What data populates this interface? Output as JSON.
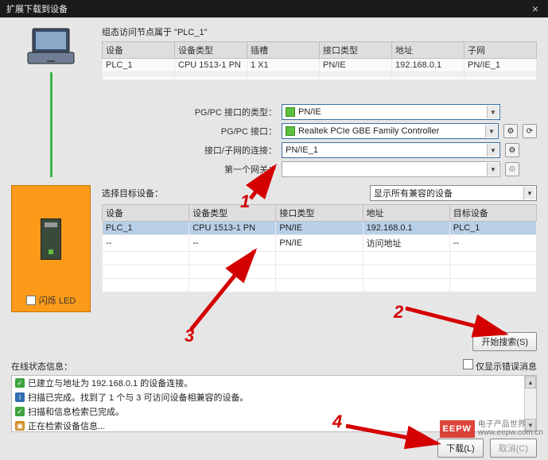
{
  "titlebar": {
    "title": "扩展下载到设备"
  },
  "topgrid": {
    "caption": "组态访问节点属于 \"PLC_1\"",
    "headers": [
      "设备",
      "设备类型",
      "插槽",
      "接口类型",
      "地址",
      "子网"
    ],
    "row": [
      "PLC_1",
      "CPU 1513-1 PN",
      "1 X1",
      "PN/IE",
      "192.168.0.1",
      "PN/IE_1"
    ]
  },
  "form": {
    "pgpc_type_label": "PG/PC 接口的类型：",
    "pgpc_type_value": "PN/IE",
    "pgpc_if_label": "PG/PC 接口：",
    "pgpc_if_value": "Realtek PCIe GBE Family Controller",
    "conn_label": "接口/子网的连接：",
    "conn_value": "PN/IE_1",
    "gateway_label": "第一个网关："
  },
  "plc_panel": {
    "led_label": "闪烁 LED"
  },
  "grid2": {
    "select_label": "选择目标设备：",
    "filter_value": "显示所有兼容的设备",
    "headers": [
      "设备",
      "设备类型",
      "接口类型",
      "地址",
      "目标设备"
    ],
    "rows": [
      [
        "PLC_1",
        "CPU 1513-1 PN",
        "PN/IE",
        "192.168.0.1",
        "PLC_1"
      ],
      [
        "--",
        "--",
        "PN/IE",
        "访问地址",
        "--"
      ]
    ],
    "search_btn": "开始搜索(S)"
  },
  "status": {
    "title": "在线状态信息：",
    "only_errors_label": "仅显示错误消息",
    "lines": [
      "已建立与地址为 192.168.0.1 的设备连接。",
      "扫描已完成。找到了 1 个与 3 可访问设备相兼容的设备。",
      "扫描和信息检索已完成。",
      "正在检索设备信息..."
    ]
  },
  "bottom": {
    "download": "下载(L)",
    "cancel": "取消(C)"
  },
  "annot": {
    "n1": "1",
    "n2": "2",
    "n3": "3",
    "n4": "4"
  },
  "watermark": {
    "logo": "EEPW",
    "text1": "电子产品世界",
    "text2": "www.eepw.com.cn"
  }
}
